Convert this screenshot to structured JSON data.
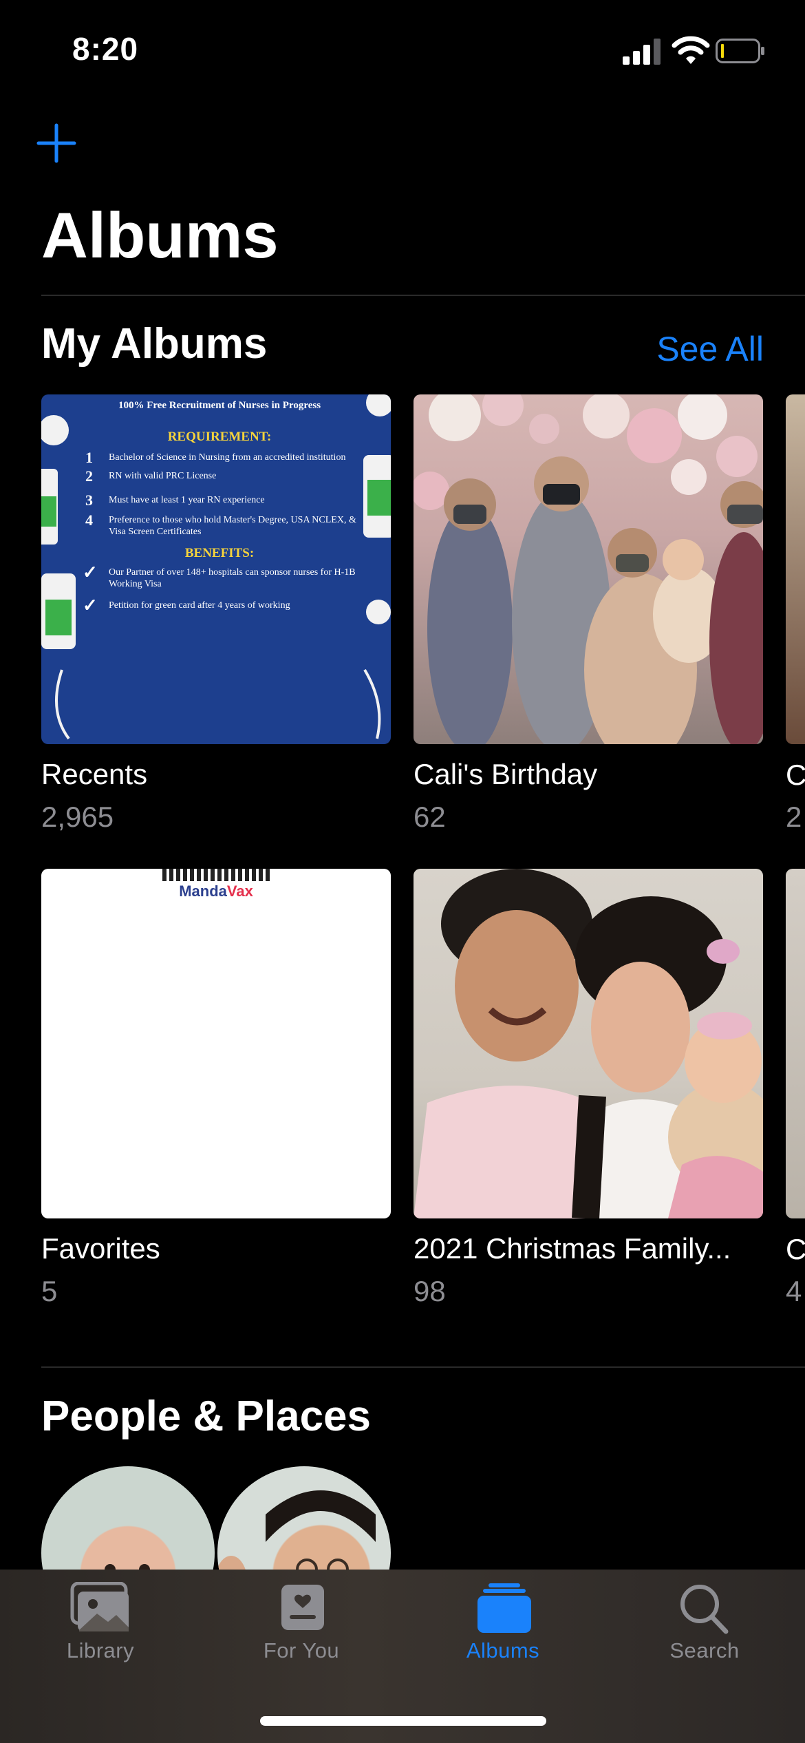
{
  "status_bar": {
    "time": "8:20"
  },
  "header": {
    "title": "Albums"
  },
  "my_albums": {
    "title": "My Albums",
    "see_all": "See All",
    "albums": [
      {
        "name": "Recents",
        "count": "2,965"
      },
      {
        "name": "Cali's Birthday",
        "count": "62"
      },
      {
        "name": "C",
        "count": "2"
      },
      {
        "name": "Favorites",
        "count": "5"
      },
      {
        "name": "2021 Christmas Family...",
        "count": "98"
      },
      {
        "name": "C",
        "count": "4"
      }
    ],
    "recents_poster": {
      "heading": "100% Free Recruitment of Nurses in Progress",
      "requirement_title": "REQUIREMENT:",
      "requirements": [
        "Bachelor of Science in Nursing from an accredited institution",
        "RN with valid PRC License",
        "Must have at least 1 year RN experience",
        "Preference to those who hold Master's Degree, USA NCLEX, & Visa Screen Certificates"
      ],
      "benefits_title": "BENEFITS:",
      "benefits": [
        "Our Partner of over 148+ hospitals can sponsor nurses for H-1B Working Visa",
        "Petition for green card after 4 years of working"
      ]
    },
    "favorites_thumb_text": {
      "part1": "Manda",
      "part2": "Vax"
    }
  },
  "people_places": {
    "title": "People & Places"
  },
  "tab_bar": {
    "tabs": [
      {
        "label": "Library",
        "icon": "photo-library-icon"
      },
      {
        "label": "For You",
        "icon": "for-you-icon"
      },
      {
        "label": "Albums",
        "icon": "albums-icon",
        "active": true
      },
      {
        "label": "Search",
        "icon": "search-icon"
      }
    ]
  },
  "colors": {
    "accent": "#1a82fb",
    "background": "#000000",
    "secondary_text": "#8d8d92"
  }
}
